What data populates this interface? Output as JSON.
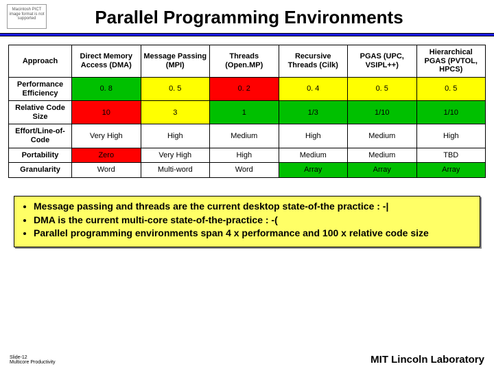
{
  "title": "Parallel Programming Environments",
  "pict_placeholder": "Macintosh PICT image format is not supported",
  "table": {
    "corner": "Approach",
    "columns": [
      "Direct Memory Access (DMA)",
      "Message Passing (MPI)",
      "Threads (Open.MP)",
      "Recursive Threads (Cilk)",
      "PGAS (UPC, VSIPL++)",
      "Hierarchical PGAS (PVTOL, HPCS)"
    ],
    "rows": [
      {
        "label": "Performance Efficiency",
        "cells": [
          {
            "v": "0. 8",
            "c": "green"
          },
          {
            "v": "0. 5",
            "c": "yellow"
          },
          {
            "v": "0. 2",
            "c": "red"
          },
          {
            "v": "0. 4",
            "c": "yellow"
          },
          {
            "v": "0. 5",
            "c": "yellow"
          },
          {
            "v": "0. 5",
            "c": "yellow"
          }
        ]
      },
      {
        "label": "Relative Code Size",
        "cells": [
          {
            "v": "10",
            "c": "red"
          },
          {
            "v": "3",
            "c": "yellow"
          },
          {
            "v": "1",
            "c": "green"
          },
          {
            "v": "1/3",
            "c": "green"
          },
          {
            "v": "1/10",
            "c": "green"
          },
          {
            "v": "1/10",
            "c": "green"
          }
        ]
      },
      {
        "label": "Effort/Line-of-Code",
        "cells": [
          {
            "v": "Very High",
            "c": ""
          },
          {
            "v": "High",
            "c": ""
          },
          {
            "v": "Medium",
            "c": ""
          },
          {
            "v": "High",
            "c": ""
          },
          {
            "v": "Medium",
            "c": ""
          },
          {
            "v": "High",
            "c": ""
          }
        ]
      },
      {
        "label": "Portability",
        "cells": [
          {
            "v": "Zero",
            "c": "red"
          },
          {
            "v": "Very High",
            "c": ""
          },
          {
            "v": "High",
            "c": ""
          },
          {
            "v": "Medium",
            "c": ""
          },
          {
            "v": "Medium",
            "c": ""
          },
          {
            "v": "TBD",
            "c": ""
          }
        ]
      },
      {
        "label": "Granularity",
        "cells": [
          {
            "v": "Word",
            "c": ""
          },
          {
            "v": "Multi-word",
            "c": ""
          },
          {
            "v": "Word",
            "c": ""
          },
          {
            "v": "Array",
            "c": "green"
          },
          {
            "v": "Array",
            "c": "green"
          },
          {
            "v": "Array",
            "c": "green"
          }
        ]
      }
    ]
  },
  "bullets": [
    "Message passing and threads are the current desktop state-of-the practice : -|",
    "DMA is the current multi-core state-of-the-practice : -(",
    "Parallel programming environments span 4 x performance and 100 x relative code size"
  ],
  "footer": {
    "slide_no": "Slide-12",
    "subtitle": "Multicore Productivity",
    "org": "MIT Lincoln Laboratory"
  }
}
